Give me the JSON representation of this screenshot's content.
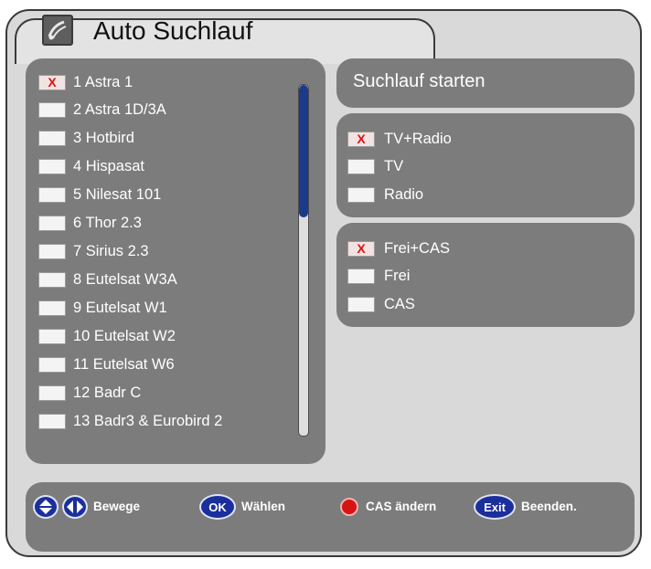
{
  "title": "Auto Suchlauf",
  "satellites": [
    {
      "label": "1 Astra 1",
      "checked": true
    },
    {
      "label": "2 Astra 1D/3A",
      "checked": false
    },
    {
      "label": "3 Hotbird",
      "checked": false
    },
    {
      "label": "4 Hispasat",
      "checked": false
    },
    {
      "label": "5 Nilesat 101",
      "checked": false
    },
    {
      "label": "6 Thor 2.3",
      "checked": false
    },
    {
      "label": "7 Sirius 2.3",
      "checked": false
    },
    {
      "label": "8 Eutelsat W3A",
      "checked": false
    },
    {
      "label": "9 Eutelsat W1",
      "checked": false
    },
    {
      "label": "10 Eutelsat W2",
      "checked": false
    },
    {
      "label": "11 Eutelsat W6",
      "checked": false
    },
    {
      "label": "12 Badr C",
      "checked": false
    },
    {
      "label": "13 Badr3 & Eurobird 2",
      "checked": false
    }
  ],
  "start_search": "Suchlauf starten",
  "service_type": [
    {
      "label": "TV+Radio",
      "checked": true
    },
    {
      "label": "TV",
      "checked": false
    },
    {
      "label": "Radio",
      "checked": false
    }
  ],
  "encryption": [
    {
      "label": "Frei+CAS",
      "checked": true
    },
    {
      "label": "Frei",
      "checked": false
    },
    {
      "label": "CAS",
      "checked": false
    }
  ],
  "check_mark": "X",
  "keys": {
    "ok_button": "OK",
    "exit_button": "Exit",
    "move": "Bewege",
    "select": "Wählen",
    "cas_change": "CAS ändern",
    "quit": "Beenden."
  },
  "colors": {
    "panel": "#7c7c7c",
    "background": "#d9d9d9",
    "key_blue": "#1b2f9c",
    "key_red": "#d61414",
    "check_red": "#dd1111",
    "scroll_thumb": "#1c3a8a"
  }
}
